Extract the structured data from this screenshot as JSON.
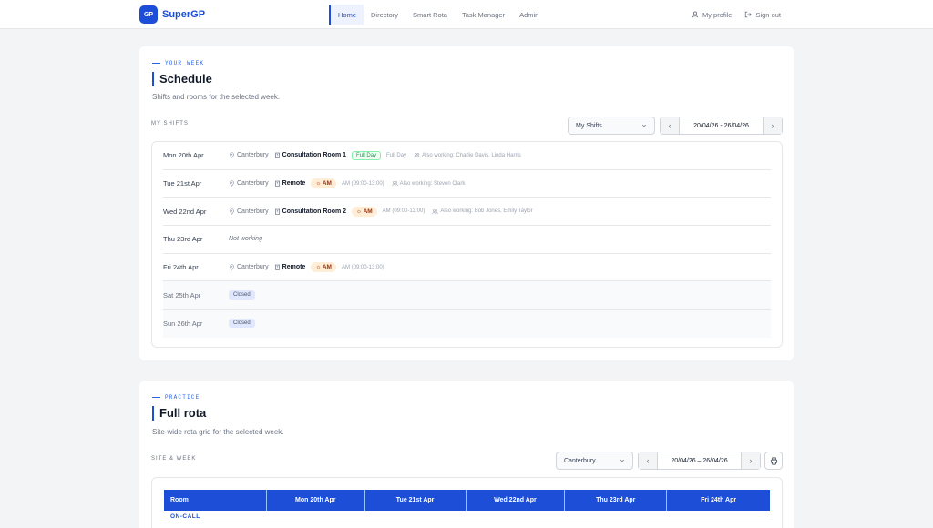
{
  "app": {
    "logo": "GP",
    "name": "SuperGP",
    "brand_color": "#1d4ed8"
  },
  "nav": {
    "links": [
      "Home",
      "Directory",
      "Smart Rota",
      "Task Manager",
      "Admin"
    ],
    "active": "Home",
    "profile": "My profile",
    "signout": "Sign out"
  },
  "schedule": {
    "eyebrow": "YOUR WEEK",
    "title": "Schedule",
    "subtitle": "Shifts and rooms for the selected week.",
    "section_label": "MY SHIFTS",
    "filter": "My Shifts",
    "week": "20/04/26 - 26/04/26",
    "rows": [
      {
        "day": "Mon 20th Apr",
        "site": "Canterbury",
        "room": "Consultation Room 1",
        "badge": "Full Day",
        "badge_type": "full",
        "time": "Full Day",
        "also": "Also working: Charlie Davis, Linda Harris"
      },
      {
        "day": "Tue 21st Apr",
        "site": "Canterbury",
        "room": "Remote",
        "badge": "AM",
        "badge_type": "am",
        "time": "AM (09:00-13:00)",
        "also": "Also working: Steven Clark"
      },
      {
        "day": "Wed 22nd Apr",
        "site": "Canterbury",
        "room": "Consultation Room 2",
        "badge": "AM",
        "badge_type": "am",
        "time": "AM (09:00-13:00)",
        "also": "Also working: Bob Jones, Emily Taylor"
      },
      {
        "day": "Thu 23rd Apr",
        "status": "Not working"
      },
      {
        "day": "Fri 24th Apr",
        "site": "Canterbury",
        "room": "Remote",
        "badge": "AM",
        "badge_type": "am",
        "time": "AM (09:00-13:00)"
      },
      {
        "day": "Sat 25th Apr",
        "closed": "Closed"
      },
      {
        "day": "Sun 26th Apr",
        "closed": "Closed"
      }
    ]
  },
  "rota": {
    "eyebrow": "PRACTICE",
    "title": "Full rota",
    "subtitle": "Site-wide rota grid for the selected week.",
    "section_label": "SITE & WEEK",
    "site": "Canterbury",
    "week": "20/04/26 – 26/04/26",
    "columns": [
      "Room",
      "Mon 20th Apr",
      "Tue 21st Apr",
      "Wed 22nd Apr",
      "Thu 23rd Apr",
      "Fri 24th Apr"
    ],
    "first_row": "ON-CALL"
  },
  "icons": [
    "user-icon",
    "signout-icon",
    "pin-icon",
    "building-icon",
    "people-icon",
    "sun-icon",
    "chevron-down-icon",
    "chevron-left-icon",
    "chevron-right-icon",
    "print-icon"
  ]
}
